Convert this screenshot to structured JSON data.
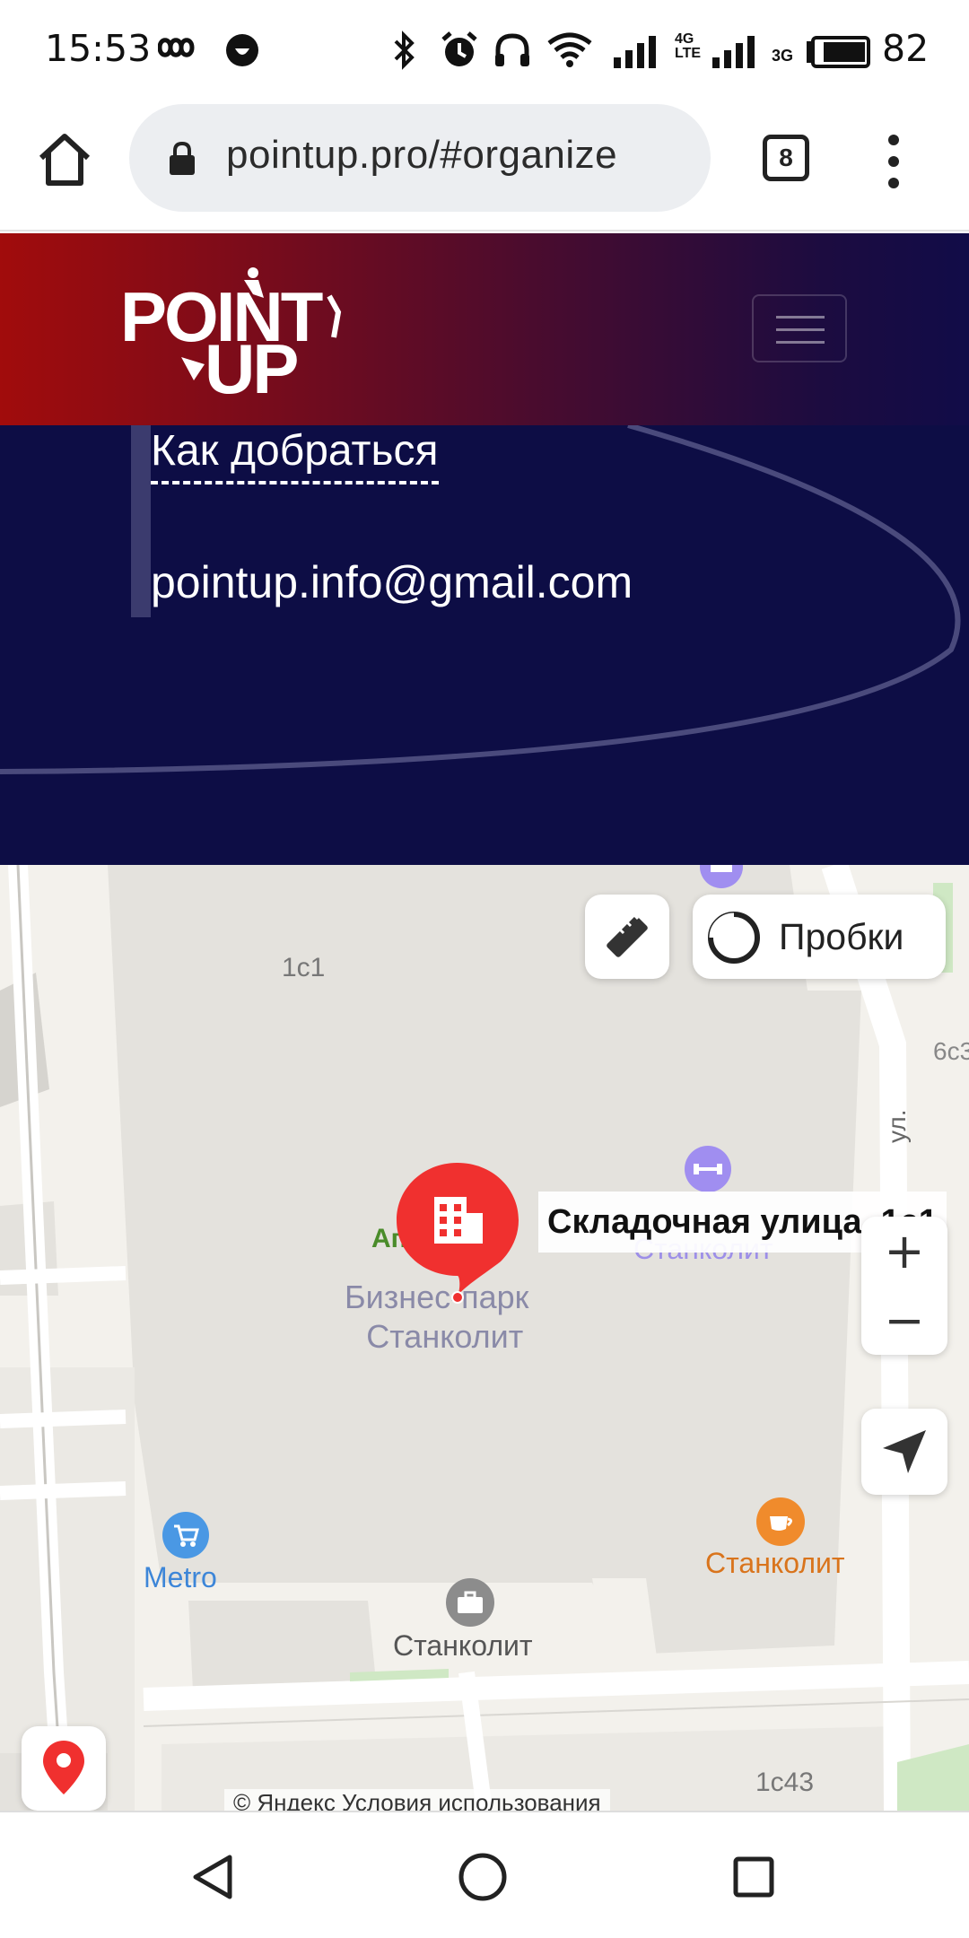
{
  "status_bar": {
    "time": "15:53",
    "battery": "82",
    "network_4g": "4G",
    "network_lte": "LTE",
    "network_3g": "3G"
  },
  "browser": {
    "url": "pointup.pro/#organize",
    "tab_count": "8"
  },
  "header": {
    "logo_line1": "POINT",
    "logo_line2": "UP",
    "brand_colors": [
      "#a10c0c",
      "#110c48"
    ]
  },
  "contact": {
    "directions_label": "Как добраться",
    "email": "pointup.info@gmail.com"
  },
  "map": {
    "traffic_label": "Пробки",
    "address": "Складочная улица, 1с1",
    "zoom_in": "+",
    "zoom_out": "−",
    "labels": {
      "building_1c1": "1с1",
      "building_6c3": "6с3",
      "building_1c43": "1с43",
      "business_park_line1": "Бизнес-парк",
      "business_park_line2": "Станколит",
      "metro": "Metro",
      "cafe": "Станколит",
      "office": "Станколит",
      "gym": "Станколит",
      "green_label": "Ап...6",
      "street": "ул.",
      "copyright": "© Яндекс  Условия использования"
    }
  }
}
